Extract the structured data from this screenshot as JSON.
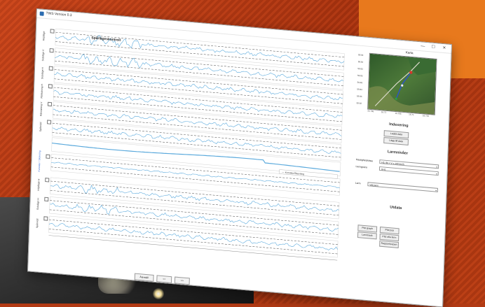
{
  "window": {
    "title": "TWS Version 0.3",
    "controls": {
      "minimize": "—",
      "maximize": "☐",
      "close": "✕"
    }
  },
  "plots": {
    "title": "Spårlägeskontroll",
    "channels": [
      {
        "label": "Höjdläge",
        "color": "#333333"
      },
      {
        "label": "Sidoläge V",
        "color": "#333333"
      },
      {
        "label": "Sidoläge H",
        "color": "#333333"
      },
      {
        "label": "Rälslutning H",
        "color": "#333333"
      },
      {
        "label": "Rälslutning V",
        "color": "#333333"
      },
      {
        "label": "Spårvidd",
        "color": "#333333"
      },
      {
        "label": "Kurvatur / Skevning",
        "color": "#3a6fd8"
      },
      {
        "label": "Höjdläge H",
        "color": "#333333"
      },
      {
        "label": "Sidoläge H",
        "color": "#333333"
      },
      {
        "label": "Spårvidd",
        "color": "#333333"
      }
    ],
    "legend_text": "— Kurvatur/Skevning",
    "bottom_buttons": [
      "Återställ",
      "<<",
      ">>"
    ]
  },
  "panel": {
    "map_title": "Karta",
    "map_y_ticks": [
      "59.84",
      "59.84",
      "59.83",
      "59.83",
      "59.83",
      "59.83",
      "59.83",
      "59.82"
    ],
    "map_x_ticks": [
      "16.705",
      "16.71",
      "16.705",
      "16.71",
      "16.715"
    ],
    "indexing_title": "Indexering",
    "load_data_label": "Ladda data",
    "add_to_data_label": "Lägg till data",
    "limits_title": "Larmnivåer",
    "speed_label": "Hastighetsklass",
    "speed_value": "H3, 80 < V ≤ 100 km/h",
    "track_type_label": "Larmgräns",
    "track_type_value": "UH1",
    "alarm_label": "Larm",
    "alarm_value": "Välj larm",
    "output_title": "Utdata",
    "output_buttons": [
      "Plot graph",
      "Plot pos",
      "Larmtrack",
      "Plot alla larm",
      "Rapport/export"
    ]
  },
  "colors": {
    "signal": "#5aa9dc",
    "dashed": "#444444",
    "map_route": "#2b55c9",
    "map_marker": "#d9362b"
  }
}
